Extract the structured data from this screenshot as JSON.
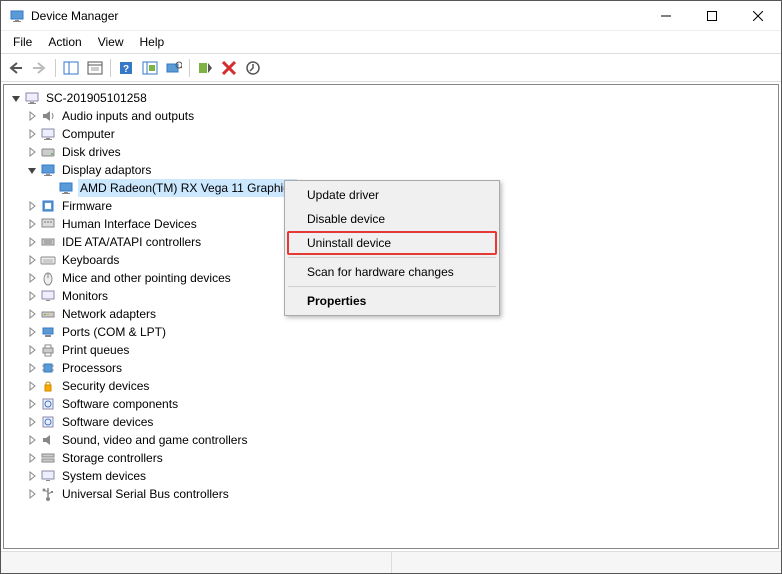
{
  "window": {
    "title": "Device Manager"
  },
  "menu": {
    "file": "File",
    "action": "Action",
    "view": "View",
    "help": "Help"
  },
  "tree": {
    "root": "SC-201905101258",
    "categories": [
      "Audio inputs and outputs",
      "Computer",
      "Disk drives",
      "Display adaptors",
      "Firmware",
      "Human Interface Devices",
      "IDE ATA/ATAPI controllers",
      "Keyboards",
      "Mice and other pointing devices",
      "Monitors",
      "Network adapters",
      "Ports (COM & LPT)",
      "Print queues",
      "Processors",
      "Security devices",
      "Software components",
      "Software devices",
      "Sound, video and game controllers",
      "Storage controllers",
      "System devices",
      "Universal Serial Bus controllers"
    ],
    "selected_device": "AMD Radeon(TM) RX Vega 11 Graphics"
  },
  "context_menu": {
    "update_driver": "Update driver",
    "disable_device": "Disable device",
    "uninstall_device": "Uninstall device",
    "scan_hardware": "Scan for hardware changes",
    "properties": "Properties"
  }
}
